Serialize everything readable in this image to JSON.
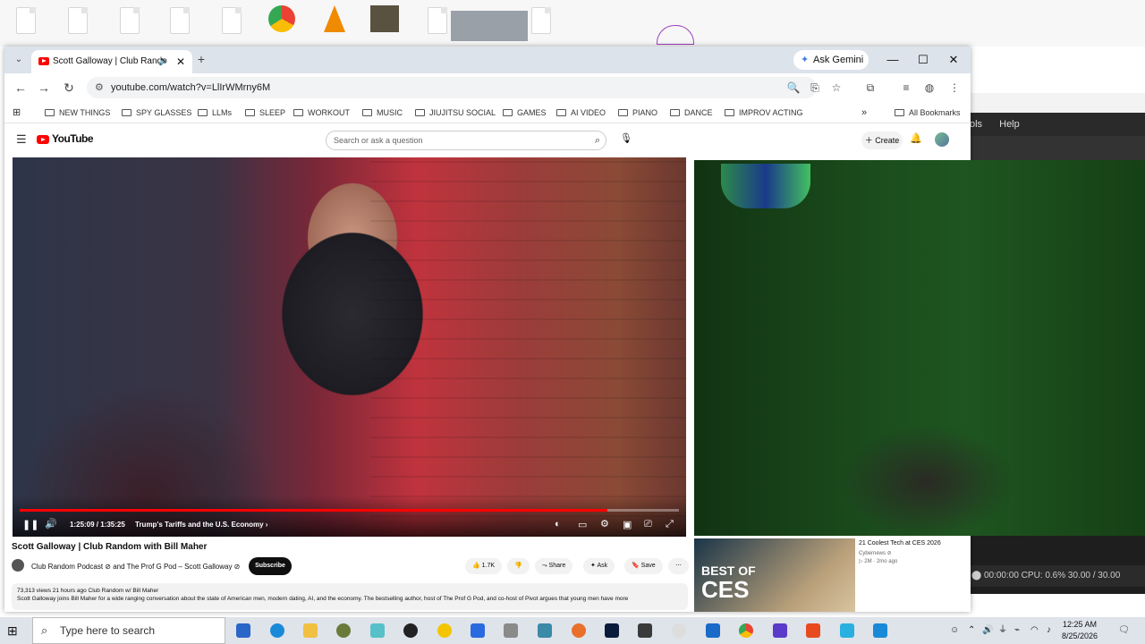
{
  "browser": {
    "tab_title": "Scott Galloway | Club Rando",
    "ask_gemini": "Ask Gemini",
    "url": "youtube.com/watch?v=LlIrWMrny6M",
    "bookmarks": [
      "NEW THINGS",
      "SPY GLASSES",
      "LLMs",
      "SLEEP",
      "WORKOUT",
      "MUSIC",
      "JIUJITSU SOCIAL",
      "GAMES",
      "AI VIDEO",
      "PIANO",
      "DANCE",
      "IMPROV ACTING"
    ],
    "all_bookmarks": "All Bookmarks"
  },
  "youtube": {
    "logo_text": "YouTube",
    "search_placeholder": "Search or ask a question",
    "create_label": "Create"
  },
  "player": {
    "time": "1:25:09 / 1:35:25",
    "chapter": "Trump's Tariffs and the U.S. Economy",
    "progress": 0.892
  },
  "video": {
    "title": "Scott Galloway | Club Random with Bill Maher",
    "channel": "Club Random Podcast ⊘ and The Prof G Pod – Scott Galloway ⊘",
    "subscribe": "Subscribe",
    "likes": "1.7K",
    "share": "Share",
    "ask": "Ask",
    "save": "Save",
    "desc_meta": "73,313 views  21 hours ago  Club Random w/ Bill Maher",
    "desc_text": "Scott Galloway joins Bill Maher for a wide ranging conversation about the state of American men, modern dating, AI, and the economy. The bestselling author, host of The Prof G Pod, and co-host of Pivot argues that young men have more"
  },
  "recommended": {
    "title": "21 Coolest Tech at CES 2026",
    "channel": "Cybernews ⊘",
    "meta": "▷ 2M · 2mo ago",
    "thumb_line1": "BEST OF",
    "thumb_line2": "CES"
  },
  "bg_app": {
    "menu": [
      "ols",
      "Help"
    ],
    "status": "⬤ 00:00:00   CPU: 0.6%   30.00 / 30.00"
  },
  "taskbar": {
    "search_placeholder": "Type here to search",
    "time": "12:25 AM",
    "date": "8/25/2026"
  },
  "colors": {
    "youtube_red": "#ff0000",
    "tab_strip": "#dde3ea",
    "taskbar": "#dfe3ea"
  }
}
